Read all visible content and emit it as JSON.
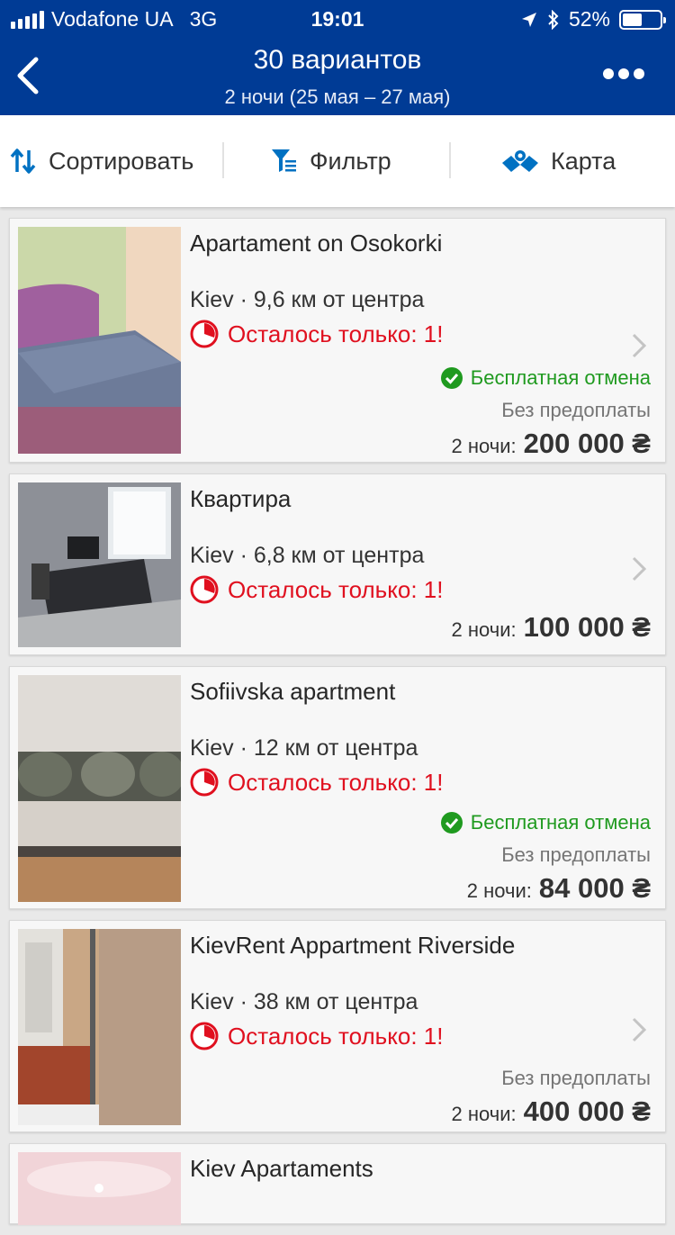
{
  "status_bar": {
    "carrier": "Vodafone UA",
    "network": "3G",
    "time": "19:01",
    "battery": "52%",
    "battery_level": 0.52
  },
  "nav": {
    "title": "30 вариантов",
    "subtitle": "2 ночи (25 мая – 27 мая)"
  },
  "toolbar": {
    "sort_label": "Сортировать",
    "filter_label": "Фильтр",
    "map_label": "Карта"
  },
  "listings": [
    {
      "name": "Apartament on Osokorki",
      "location": "Kiev · 9,6 км от центра",
      "urgency": "Осталось только: 1!",
      "free_cancel": "Бесплатная отмена",
      "no_prepay": "Без предоплаты",
      "nights_label": "2 ночи:",
      "price": "200 000 ₴"
    },
    {
      "name": "Квартира",
      "location": "Kiev · 6,8 км от центра",
      "urgency": "Осталось только: 1!",
      "nights_label": "2 ночи:",
      "price": "100 000 ₴"
    },
    {
      "name": "Sofiivska apartment",
      "location": "Kiev · 12 км от центра",
      "urgency": "Осталось только: 1!",
      "free_cancel": "Бесплатная отмена",
      "no_prepay": "Без предоплаты",
      "nights_label": "2 ночи:",
      "price": "84 000 ₴"
    },
    {
      "name": "KievRent Appartment Riverside",
      "location": "Kiev · 38 км от центра",
      "urgency": "Осталось только: 1!",
      "no_prepay": "Без предоплаты",
      "nights_label": "2 ночи:",
      "price": "400 000 ₴"
    },
    {
      "name": "Kiev Apartaments"
    }
  ],
  "colors": {
    "brand": "#003b95",
    "urgent": "#e0101f",
    "success": "#1f9a1f"
  }
}
